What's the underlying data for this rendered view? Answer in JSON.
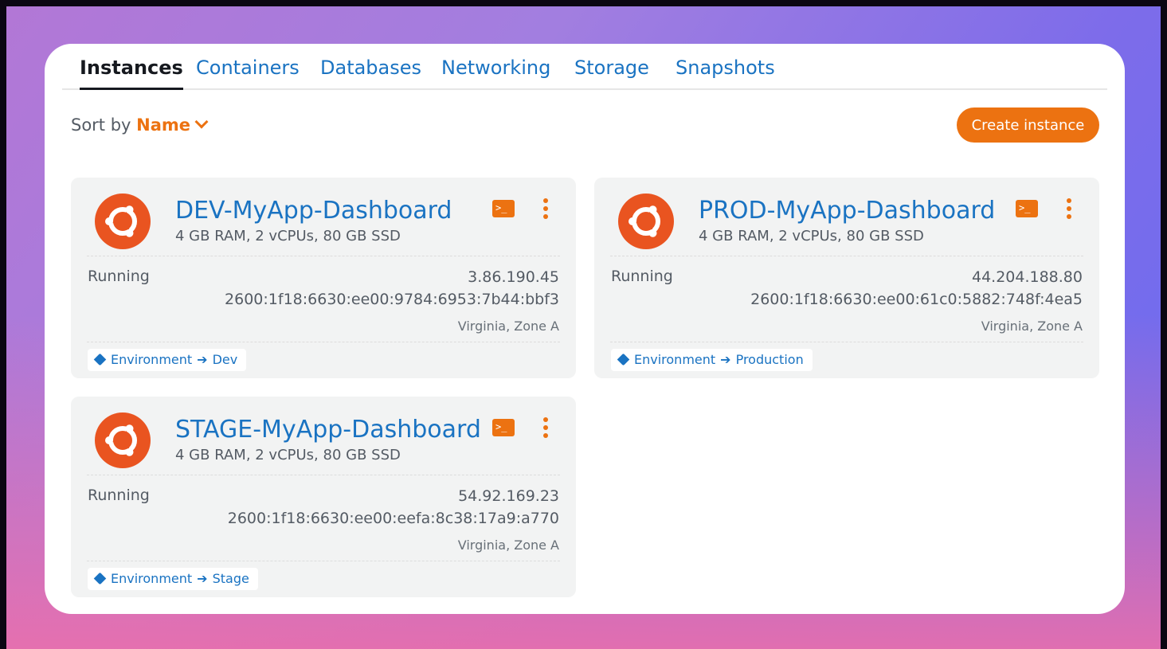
{
  "tabs": [
    {
      "label": "Instances",
      "active": true
    },
    {
      "label": "Containers",
      "active": false
    },
    {
      "label": "Databases",
      "active": false
    },
    {
      "label": "Networking",
      "active": false
    },
    {
      "label": "Storage",
      "active": false
    },
    {
      "label": "Snapshots",
      "active": false
    }
  ],
  "toolbar": {
    "sort_label": "Sort by",
    "sort_value": "Name",
    "create_label": "Create instance"
  },
  "instances": [
    {
      "name": "DEV-MyApp-Dashboard",
      "spec": "4 GB RAM, 2 vCPUs, 80 GB SSD",
      "status": "Running",
      "ipv4": "3.86.190.45",
      "ipv6": "2600:1f18:6630:ee00:9784:6953:7b44:bbf3",
      "zone": "Virginia, Zone A",
      "tag_key": "Environment",
      "tag_value": "Dev",
      "terminal_glyph": ">_"
    },
    {
      "name": "PROD-MyApp-Dashboard",
      "spec": "4 GB RAM, 2 vCPUs, 80 GB SSD",
      "status": "Running",
      "ipv4": "44.204.188.80",
      "ipv6": "2600:1f18:6630:ee00:61c0:5882:748f:4ea5",
      "zone": "Virginia, Zone A",
      "tag_key": "Environment",
      "tag_value": "Production",
      "terminal_glyph": ">_"
    },
    {
      "name": "STAGE-MyApp-Dashboard",
      "spec": "4 GB RAM, 2 vCPUs, 80 GB SSD",
      "status": "Running",
      "ipv4": "54.92.169.23",
      "ipv6": "2600:1f18:6630:ee00:eefa:8c38:17a9:a770",
      "zone": "Virginia, Zone A",
      "tag_key": "Environment",
      "tag_value": "Stage",
      "terminal_glyph": ">_"
    }
  ],
  "colors": {
    "accent": "#ec7211",
    "link": "#1a73c2",
    "ubuntu": "#e95420"
  }
}
